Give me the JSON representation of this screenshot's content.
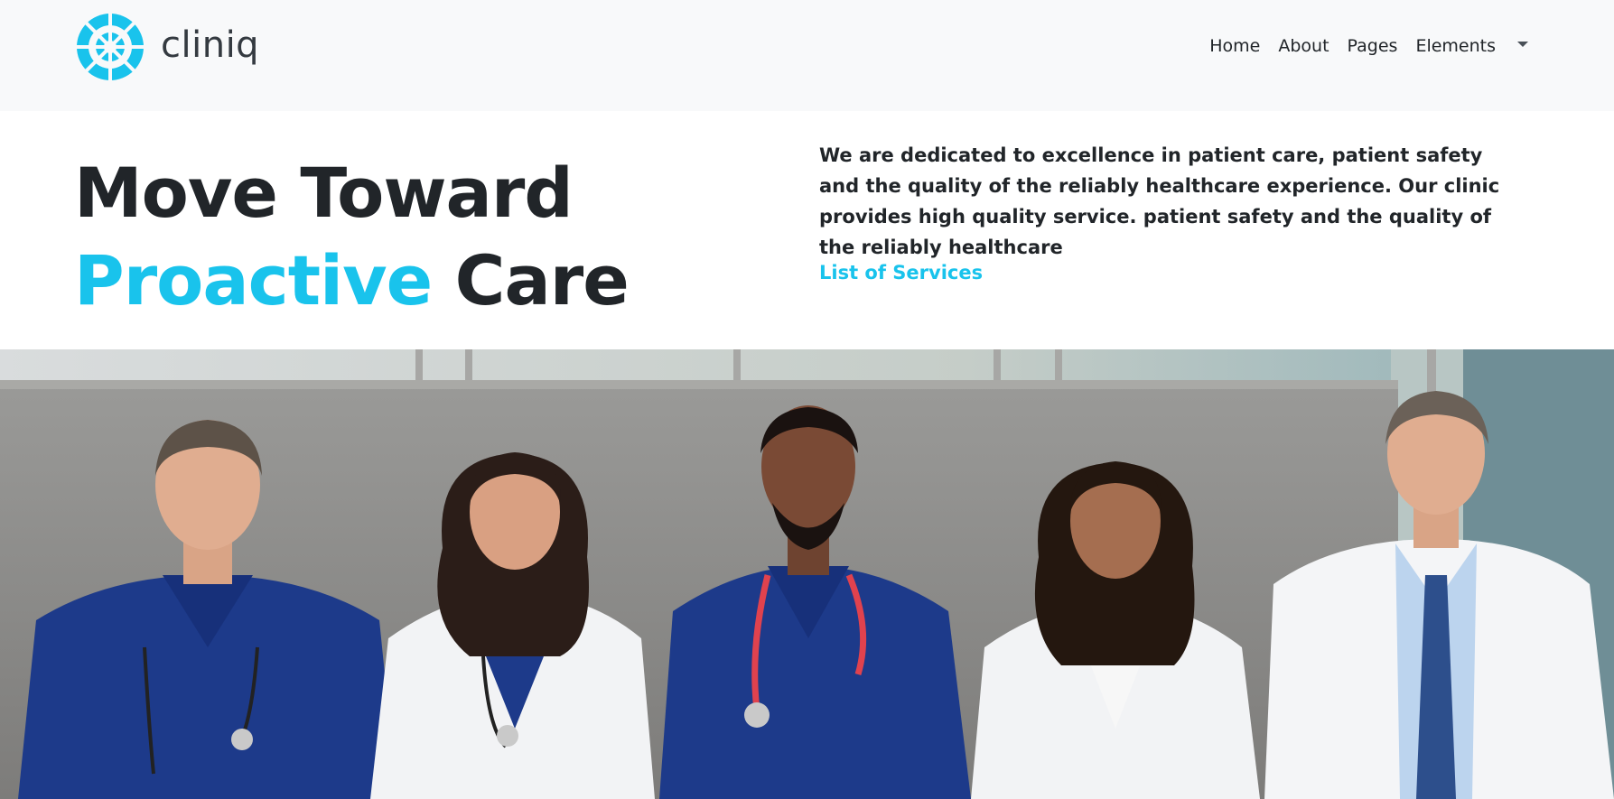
{
  "brand": {
    "name": "cliniq",
    "logo_icon": "cliniq-logo-icon",
    "color": "#19c3ec"
  },
  "nav": {
    "items": [
      "Home",
      "About",
      "Pages",
      "Elements"
    ],
    "dropdown_icon": "caret-down-icon"
  },
  "hero": {
    "title_line1": "Move Toward",
    "title_accent": "Proactive",
    "title_rest": "Care",
    "description": "We are dedicated to excellence in patient care, patient safety and the quality of the reliably healthcare experience. Our clinic provides high quality service. patient safety and the quality of the reliably healthcare",
    "link_label": "List of Services"
  },
  "photo": {
    "subject": "team-photo"
  },
  "colors": {
    "accent": "#19c3ec",
    "text": "#212529",
    "navbar_bg": "#f8f9fa"
  }
}
